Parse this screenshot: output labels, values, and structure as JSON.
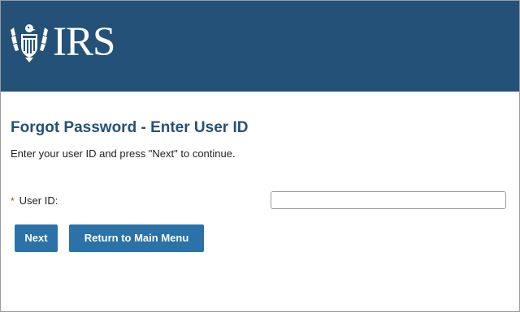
{
  "header": {
    "logo_text": "IRS",
    "logo_icon": "irs-eagle-icon",
    "background": "#245178"
  },
  "main": {
    "title": "Forgot Password - Enter User ID",
    "instructions": "Enter your user ID and press \"Next\" to continue.",
    "form": {
      "required_marker": "*",
      "user_id_label": "User ID:",
      "user_id_value": "",
      "user_id_placeholder": ""
    },
    "buttons": {
      "next_label": "Next",
      "return_label": "Return to Main Menu"
    }
  },
  "colors": {
    "title": "#245178",
    "button": "#2a72a8",
    "required": "#c0392b"
  }
}
